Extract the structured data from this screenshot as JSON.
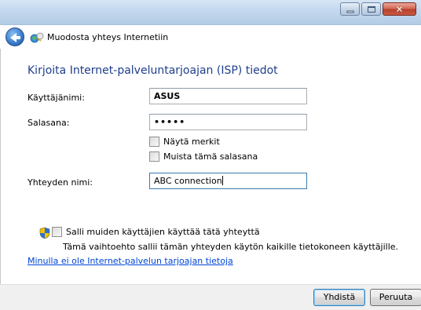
{
  "window": {
    "title": "Muodosta yhteys Internetiin",
    "close_glyph": "✕"
  },
  "heading": "Kirjoita Internet-palveluntarjoajan (ISP) tiedot",
  "form": {
    "username_label": "Käyttäjänimi:",
    "username_value": "ASUS",
    "password_label": "Salasana:",
    "password_value": "•••••",
    "show_chars_label": "Näytä merkit",
    "remember_password_label": "Muista tämä salasana",
    "connection_name_label": "Yhteyden nimi:",
    "connection_name_value": "ABC connection"
  },
  "sharing": {
    "allow_others_label": "Salli muiden käyttäjien käyttää tätä yhteyttä",
    "description": "Tämä vaihtoehto sallii tämän yhteyden käytön kaikille tietokoneen käyttäjille."
  },
  "link_text": "Minulla ei ole Internet-palvelun tarjoajan tietoja",
  "buttons": {
    "connect": "Yhdistä",
    "cancel": "Peruuta"
  },
  "colors": {
    "heading": "#1e3e8c",
    "link": "#0046d5",
    "titlebar": "#c3d8ee"
  },
  "icons": {
    "back": "back-arrow-icon",
    "app": "network-globe-icon",
    "uac": "uac-shield-icon"
  }
}
